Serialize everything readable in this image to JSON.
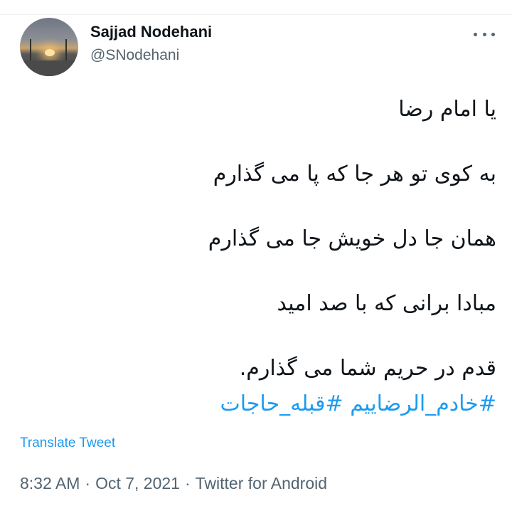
{
  "user": {
    "display_name": "Sajjad Nodehani",
    "handle": "@SNodehani"
  },
  "tweet": {
    "lines": [
      "یا امام رضا",
      "به کوی تو هر جا که پا می گذارم",
      "همان جا دل خویش جا می گذارم",
      "مبادا برانی که با صد امید",
      "قدم در حریم شما می گذارم."
    ],
    "hashtags": [
      "#خادم_الرضاییم",
      "#قبله_حاجات"
    ]
  },
  "translate_label": "Translate Tweet",
  "meta": {
    "time": "8:32 AM",
    "separator": "·",
    "date": "Oct 7, 2021",
    "source": "Twitter for Android"
  }
}
